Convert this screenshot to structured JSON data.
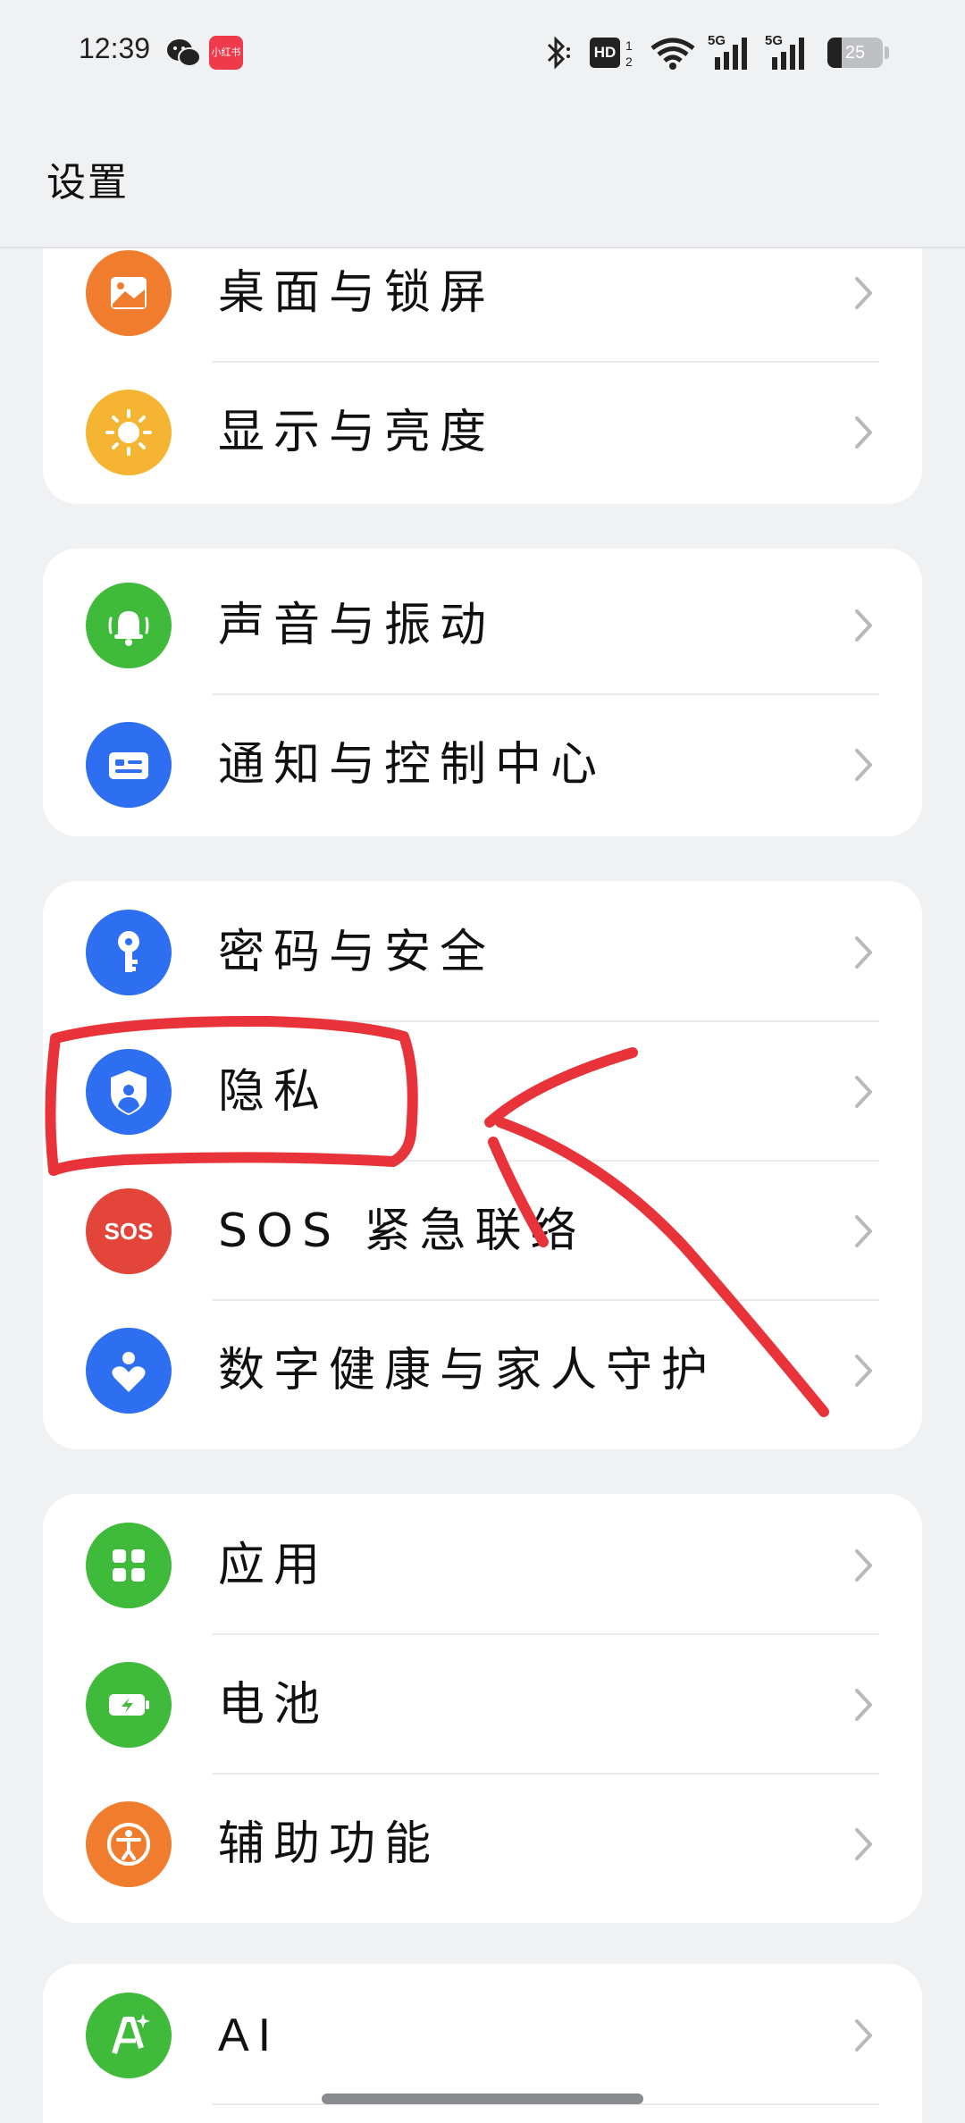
{
  "status_bar": {
    "time": "12:39",
    "icons": [
      "wechat-icon",
      "xiaohongshu-icon",
      "bluetooth-icon",
      "hd-icon",
      "wifi-icon",
      "signal-5g-icon",
      "signal-5g-icon",
      "battery-icon"
    ],
    "app_badge": "小红书",
    "hd_label": "HD",
    "sim_label": "5G",
    "battery_level": "25",
    "battery_percent": 0.25
  },
  "header": {
    "title": "设置"
  },
  "groups": [
    {
      "items": [
        {
          "label": "桌面与锁屏",
          "icon": "wallpaper-icon",
          "color": "#f07d2e"
        },
        {
          "label": "显示与亮度",
          "icon": "sun-icon",
          "color": "#f5b532"
        }
      ]
    },
    {
      "items": [
        {
          "label": "声音与振动",
          "icon": "bell-icon",
          "color": "#3fba3a"
        },
        {
          "label": "通知与控制中心",
          "icon": "notification-icon",
          "color": "#2e6ef0"
        }
      ]
    },
    {
      "items": [
        {
          "label": "密码与安全",
          "icon": "key-icon",
          "color": "#2e6ef0"
        },
        {
          "label": "隐私",
          "icon": "privacy-shield-icon",
          "color": "#2e6ef0"
        },
        {
          "label": "SOS 紧急联络",
          "icon": "sos-icon",
          "icon_text": "SOS",
          "color": "#e3453b"
        },
        {
          "label": "数字健康与家人守护",
          "icon": "heart-person-icon",
          "color": "#2e6ef0"
        }
      ]
    },
    {
      "items": [
        {
          "label": "应用",
          "icon": "apps-grid-icon",
          "color": "#3fba3a"
        },
        {
          "label": "电池",
          "icon": "battery-charge-icon",
          "color": "#3fba3a"
        },
        {
          "label": "辅助功能",
          "icon": "accessibility-icon",
          "color": "#f07d2e"
        }
      ]
    },
    {
      "items": [
        {
          "label": "AI",
          "icon": "ai-sparkle-icon",
          "color": "#3fba3a"
        }
      ]
    }
  ],
  "annotation": {
    "color": "#e8333a",
    "target": "隐私"
  }
}
